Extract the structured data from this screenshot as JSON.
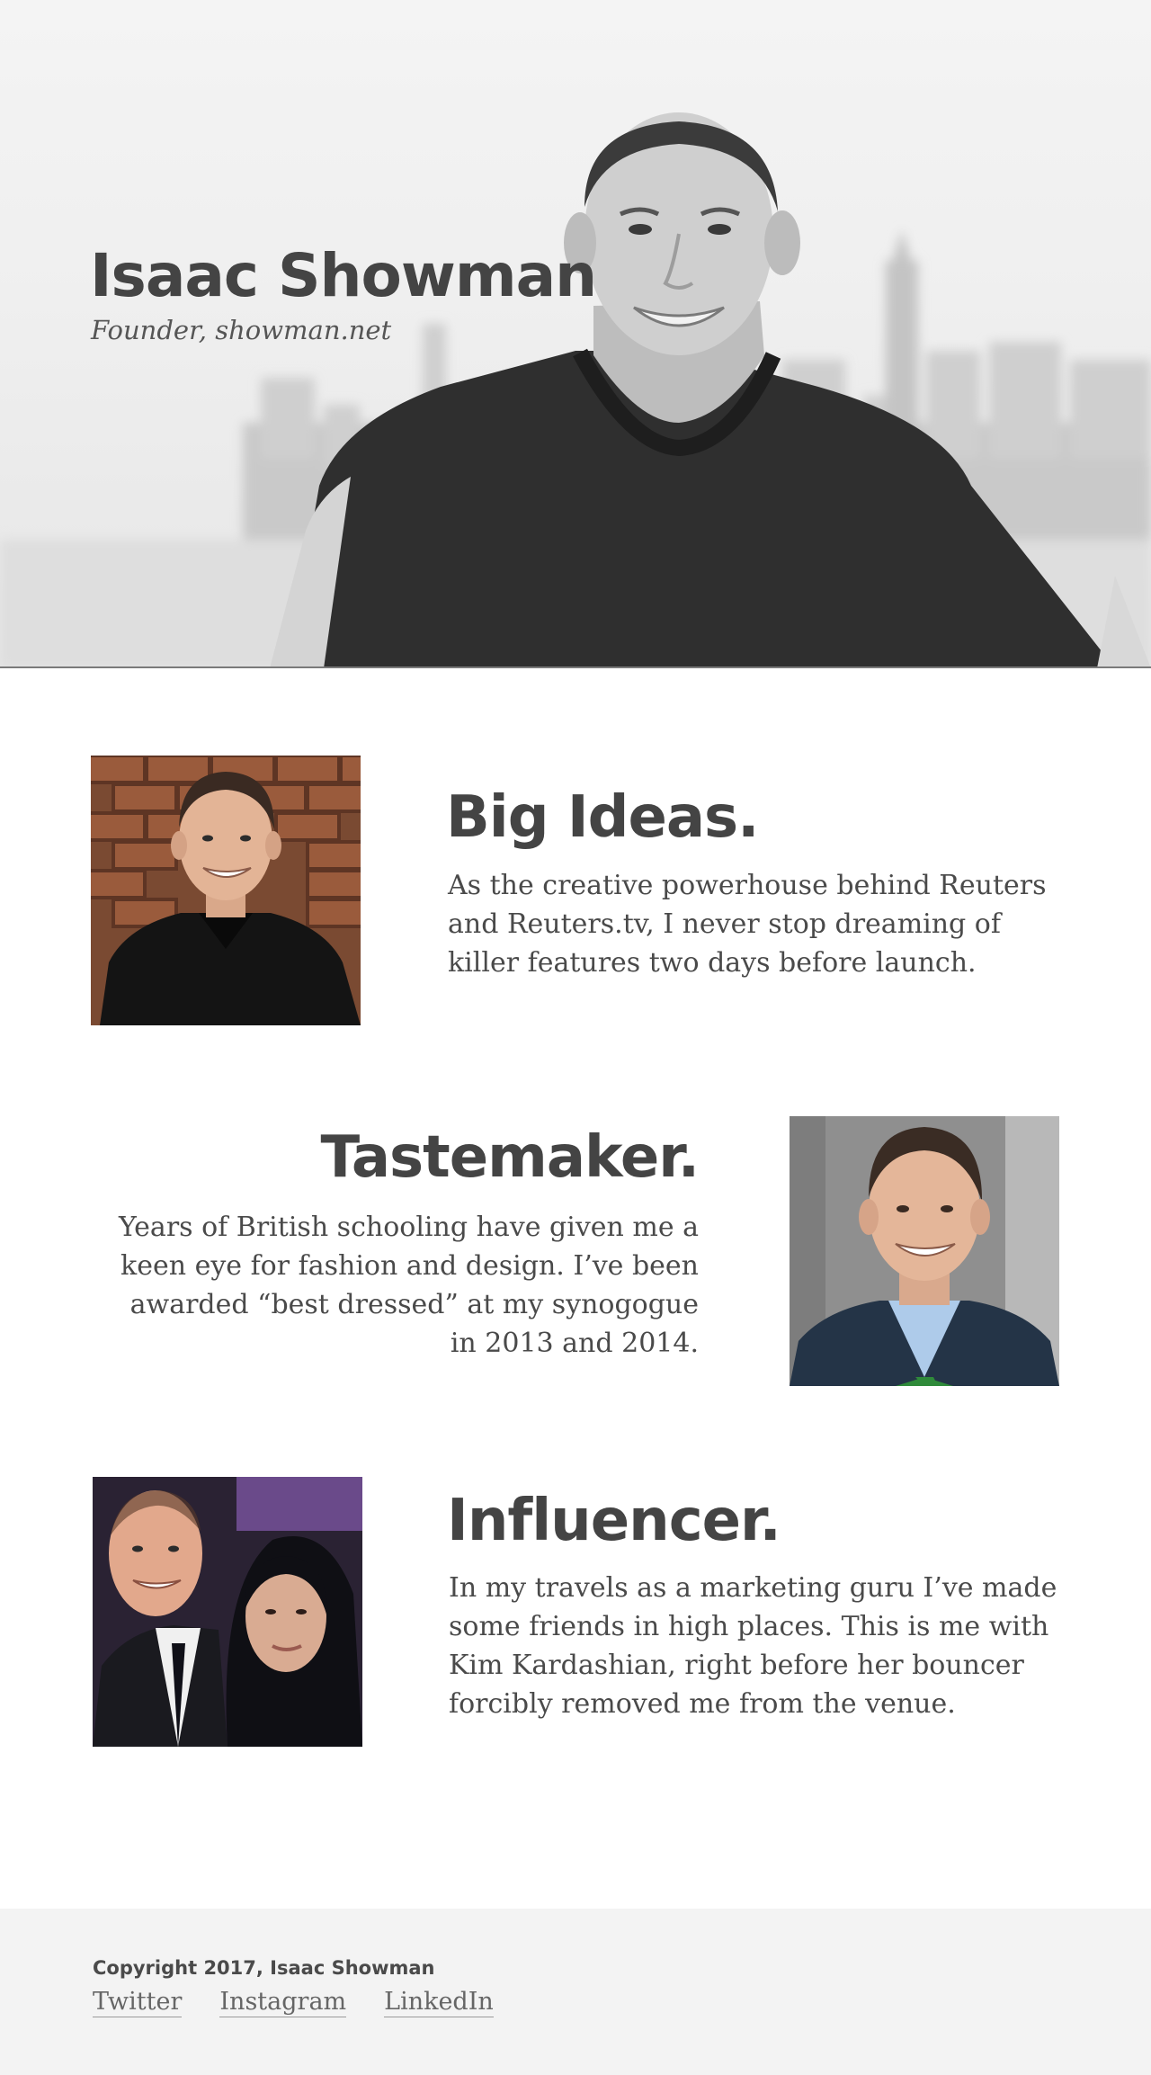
{
  "hero": {
    "name": "Isaac Showman",
    "subtitle": "Founder, showman.net"
  },
  "sections": [
    {
      "title": "Big Ideas.",
      "text": "As the creative powerhouse behind Reuters and Reuters.tv, I never stop dreaming of killer features two days before launch."
    },
    {
      "title": "Tastemaker.",
      "text": "Years of British schooling have given me a keen eye for fashion and design. I’ve been awarded  “best dressed” at my synogogue in 2013 and 2014."
    },
    {
      "title": "Influencer.",
      "text": "In my travels as a marketing guru I’ve made some friends in high places. This is me with Kim Kardashian, right before her bouncer forcibly removed me from the venue."
    }
  ],
  "footer": {
    "copyright": "Copyright 2017, Isaac Showman",
    "links": [
      "Twitter",
      "Instagram",
      "LinkedIn"
    ]
  },
  "colors": {
    "text": "#444444",
    "hero_bg": "#f1f1f1",
    "footer_bg": "#f3f3f3",
    "divider": "#7a7a7a"
  }
}
